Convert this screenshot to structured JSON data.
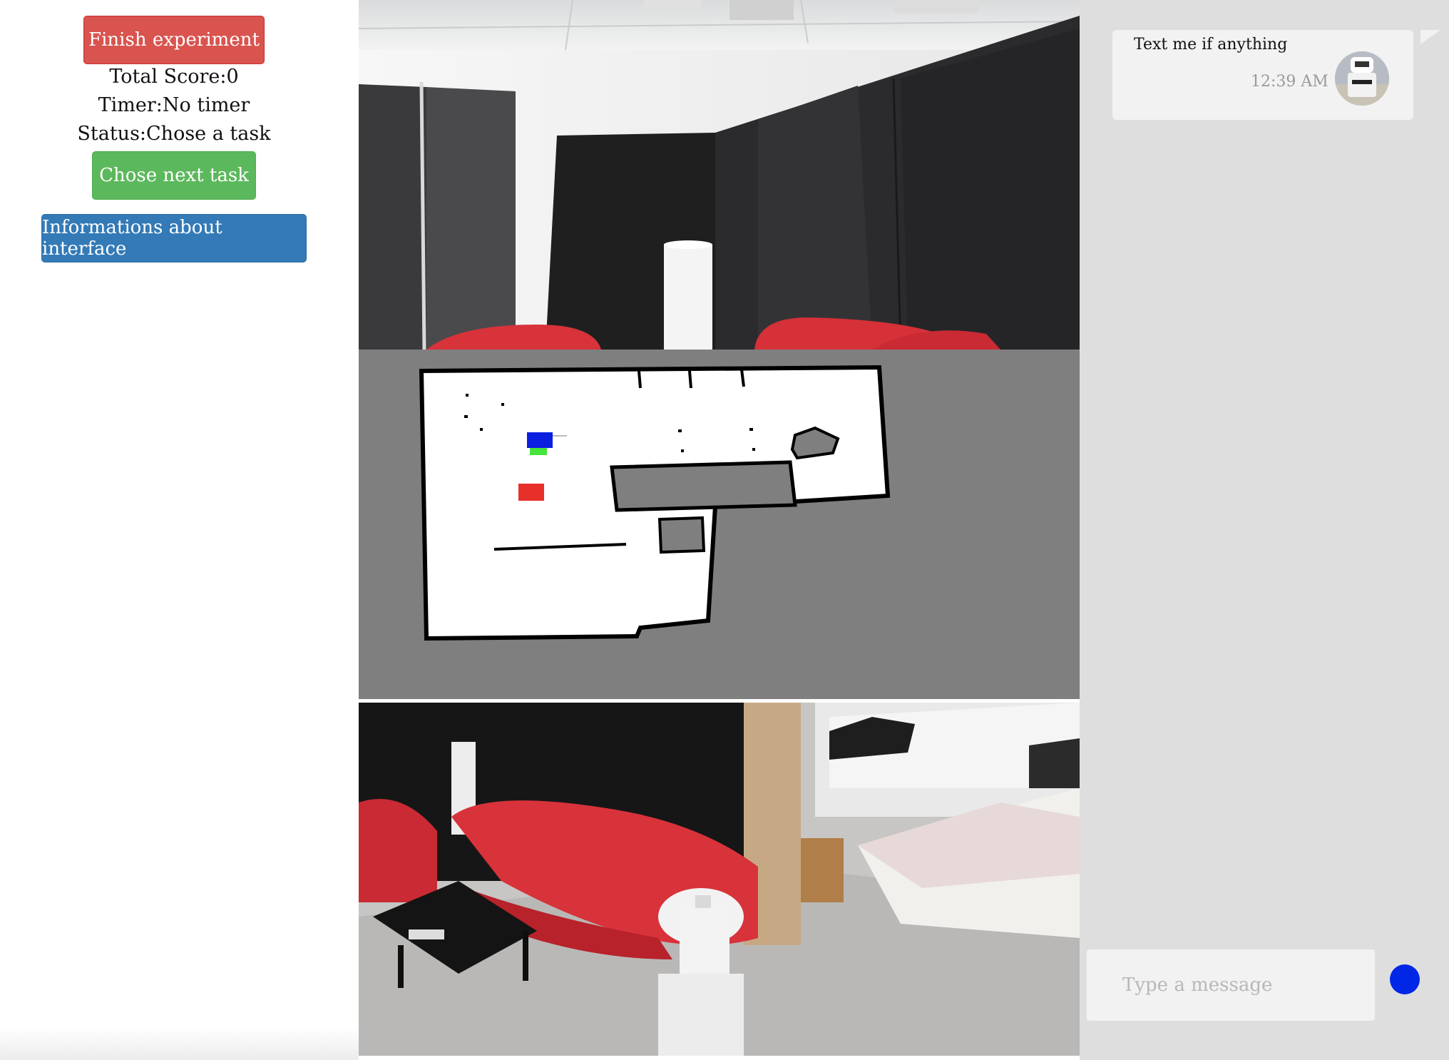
{
  "controls": {
    "finish_label": "Finish experiment",
    "score_text": "Total Score:0",
    "timer_text": "Timer:No timer",
    "status_text": "Status:Chose a task",
    "next_task_label": "Chose next task",
    "info_label": "Informations about interface"
  },
  "chat": {
    "messages": [
      {
        "text": "Text me if anything",
        "time": "12:39 AM"
      }
    ],
    "input_placeholder": "Type a message"
  },
  "colors": {
    "finish_button": "#d9534f",
    "next_task_button": "#5cb85c",
    "info_button": "#337ab7",
    "send_button": "#0026e6",
    "robot_marker": "#0a1fe0",
    "goal_marker": "#e8302a",
    "robot_heading": "#44e43a"
  }
}
